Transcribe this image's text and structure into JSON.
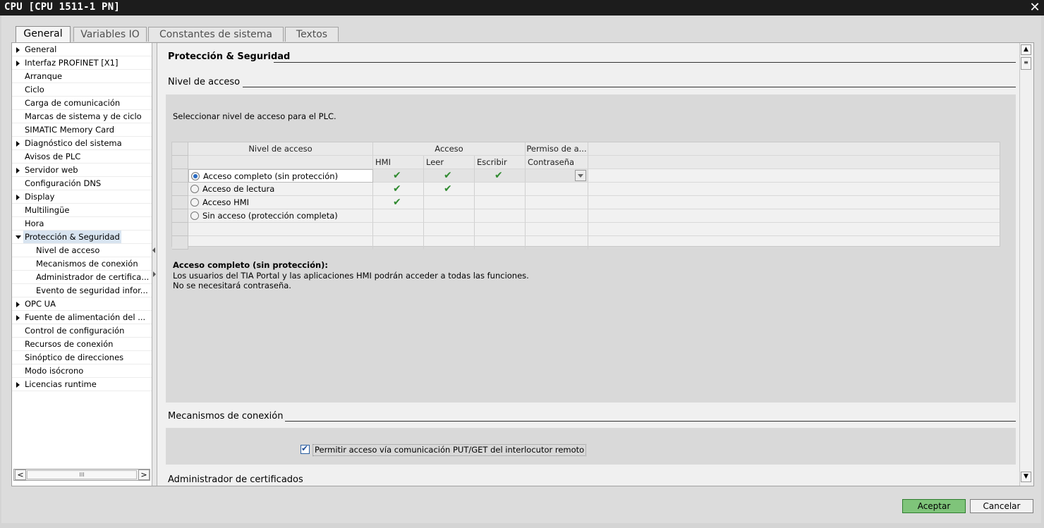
{
  "window": {
    "title": "CPU [CPU 1511-1 PN]",
    "close_glyph": "✕"
  },
  "tabs": [
    {
      "label": "General",
      "active": true
    },
    {
      "label": "Variables IO",
      "active": false
    },
    {
      "label": "Constantes de sistema",
      "active": false
    },
    {
      "label": "Textos",
      "active": false
    }
  ],
  "nav": {
    "items": [
      {
        "label": "General",
        "expandable": true
      },
      {
        "label": "Interfaz PROFINET [X1]",
        "expandable": true
      },
      {
        "label": "Arranque",
        "expandable": false
      },
      {
        "label": "Ciclo",
        "expandable": false
      },
      {
        "label": "Carga de comunicación",
        "expandable": false
      },
      {
        "label": "Marcas de sistema y de ciclo",
        "expandable": false
      },
      {
        "label": "SIMATIC Memory Card",
        "expandable": false
      },
      {
        "label": "Diagnóstico del sistema",
        "expandable": true
      },
      {
        "label": "Avisos de PLC",
        "expandable": false
      },
      {
        "label": "Servidor web",
        "expandable": true
      },
      {
        "label": "Configuración DNS",
        "expandable": false
      },
      {
        "label": "Display",
        "expandable": true
      },
      {
        "label": "Multilingüe",
        "expandable": false
      },
      {
        "label": "Hora",
        "expandable": false
      },
      {
        "label": "Protección & Seguridad",
        "expanded": true,
        "selected": true
      },
      {
        "label": "Nivel de acceso",
        "sub": true
      },
      {
        "label": "Mecanismos de conexión",
        "sub": true
      },
      {
        "label": "Administrador de certifica...",
        "sub": true
      },
      {
        "label": "Evento de seguridad infor...",
        "sub": true
      },
      {
        "label": "OPC UA",
        "expandable": true
      },
      {
        "label": "Fuente de alimentación del ...",
        "expandable": true
      },
      {
        "label": "Control de configuración",
        "expandable": false
      },
      {
        "label": "Recursos de conexión",
        "expandable": false
      },
      {
        "label": "Sinóptico de direcciones",
        "expandable": false
      },
      {
        "label": "Modo isócrono",
        "expandable": false
      },
      {
        "label": "Licencias runtime",
        "expandable": true
      }
    ],
    "hscroll": {
      "left": "<",
      "right": ">",
      "thumb": "III"
    }
  },
  "main": {
    "section_title": "Protección & Seguridad",
    "access_level": {
      "title": "Nivel de acceso",
      "instruction": "Seleccionar nivel de acceso para el PLC.",
      "table": {
        "headers": {
          "level": "Nivel de acceso",
          "access": "Acceso",
          "permission": "Permiso de a...",
          "hmi": "HMI",
          "read": "Leer",
          "write": "Escribir",
          "password": "Contraseña"
        },
        "rows": [
          {
            "label": "Acceso completo (sin protección)",
            "selected": true,
            "hmi": true,
            "read": true,
            "write": true,
            "check_glyph": "✔"
          },
          {
            "label": "Acceso de lectura",
            "selected": false,
            "hmi": true,
            "read": true,
            "write": false,
            "check_glyph": "✔"
          },
          {
            "label": "Acceso HMI",
            "selected": false,
            "hmi": true,
            "read": false,
            "write": false,
            "check_glyph": "✔"
          },
          {
            "label": "Sin acceso (protección completa)",
            "selected": false,
            "hmi": false,
            "read": false,
            "write": false,
            "check_glyph": "✔"
          }
        ]
      },
      "description": {
        "title": "Acceso completo (sin protección):",
        "line1": "Los usuarios del TIA Portal y las aplicaciones HMI podrán acceder a todas las funciones.",
        "line2": "No se necesitará contraseña."
      }
    },
    "connection": {
      "title": "Mecanismos de conexión",
      "putget_label": "Permitir acceso vía comunicación PUT/GET del interlocutor remoto",
      "putget_checked": true
    },
    "certificates": {
      "title": "Administrador de certificados"
    }
  },
  "vscroll": {
    "up": "▲",
    "down": "▼",
    "thumb": "≡"
  },
  "buttons": {
    "ok": "Aceptar",
    "cancel": "Cancelar"
  }
}
